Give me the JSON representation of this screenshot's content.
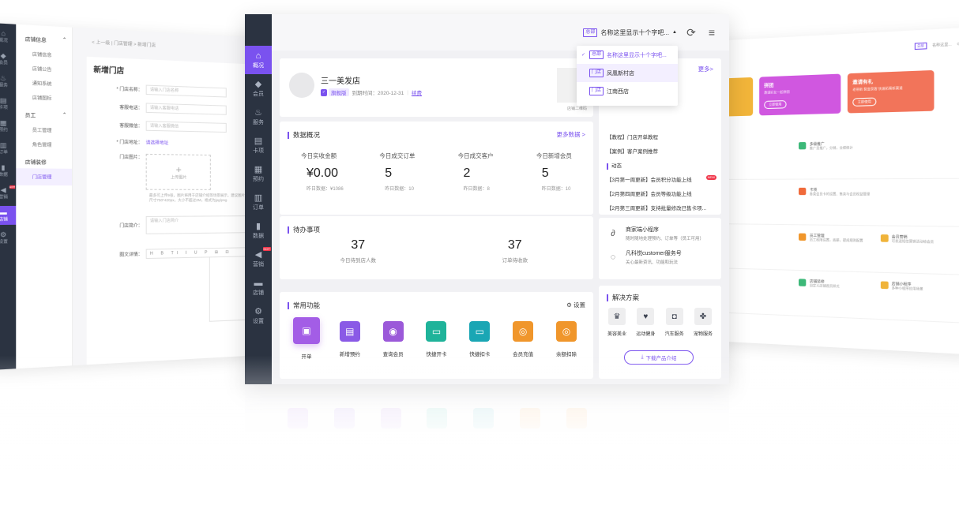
{
  "left_panel": {
    "sidebar": [
      {
        "label": "概况",
        "icon": "home-icon"
      },
      {
        "label": "会员",
        "icon": "diamond-icon"
      },
      {
        "label": "服务",
        "icon": "service-icon"
      },
      {
        "label": "卡项",
        "icon": "card-icon"
      },
      {
        "label": "预约",
        "icon": "calendar-icon"
      },
      {
        "label": "订单",
        "icon": "order-icon"
      },
      {
        "label": "数据",
        "icon": "chart-icon"
      },
      {
        "label": "营销",
        "icon": "megaphone-icon",
        "badge": "HOT"
      },
      {
        "label": "店铺",
        "icon": "shop-icon",
        "active": true
      },
      {
        "label": "设置",
        "icon": "gear-icon"
      }
    ],
    "submenu": {
      "group1": "店铺信息",
      "group1_items": [
        "店铺信息",
        "店铺公告",
        "通知系统",
        "店铺图标"
      ],
      "group2": "员工",
      "group2_items": [
        "员工管理",
        "角色管理"
      ],
      "group3": "店铺装修",
      "active_item": "门店管理"
    },
    "breadcrumb": "< 上一级 | 门店管理 > 新增门店",
    "form": {
      "title": "新增门店",
      "fields": [
        {
          "label": "* 门店名称：",
          "placeholder": "请输入门店名称"
        },
        {
          "label": "客服电话：",
          "placeholder": "请输入客服电话"
        },
        {
          "label": "客服微信：",
          "placeholder": "请输入客服微信"
        }
      ],
      "address_label": "* 门店地址：",
      "address_link": "请选择地址",
      "image_label": "门店图片：",
      "upload_label": "上传图片",
      "upload_hint": "最多可上传9张，图片将用于店铺介绍等场景展示，建议图片尺寸750*420px，大小不超过2M，格式为jpg/png",
      "intro_label": "门店简介：",
      "intro_placeholder": "请输入门店简介",
      "detail_label": "图文详情：",
      "toolbar": "H B TI I U P ⊞ ⊟"
    }
  },
  "center_panel": {
    "sidebar": [
      {
        "label": "概况",
        "icon": "home-icon",
        "active": true
      },
      {
        "label": "会员",
        "icon": "diamond-icon"
      },
      {
        "label": "服务",
        "icon": "service-icon"
      },
      {
        "label": "卡项",
        "icon": "card-icon"
      },
      {
        "label": "预约",
        "icon": "calendar-icon"
      },
      {
        "label": "订单",
        "icon": "order-icon"
      },
      {
        "label": "数据",
        "icon": "chart-icon"
      },
      {
        "label": "营销",
        "icon": "megaphone-icon",
        "badge": "HOT"
      },
      {
        "label": "店铺",
        "icon": "shop-icon"
      },
      {
        "label": "设置",
        "icon": "gear-icon"
      }
    ],
    "topbar": {
      "store_tag": "总部",
      "store_name": "名称这里显示十个字吧..."
    },
    "dropdown": [
      {
        "tag": "总部",
        "name": "名称这里显示十个字吧...",
        "selected": true
      },
      {
        "tag": "门店",
        "name": "凤凰新村店",
        "hover": true
      },
      {
        "tag": "门店",
        "name": "江南西店"
      }
    ],
    "store": {
      "name": "三一美发店",
      "plan": "旗舰版",
      "expire": "到期时间：2020-12-31",
      "renew": "续费",
      "qr_label": "店铺二维码"
    },
    "overview": {
      "title": "数据概况",
      "more": "更多数据 >",
      "stats": [
        {
          "label": "今日实收金额",
          "value": "¥0.00",
          "yesterday": "昨日数据：¥1086"
        },
        {
          "label": "今日成交订单",
          "value": "5",
          "yesterday": "昨日数据：10"
        },
        {
          "label": "今日成交客户",
          "value": "2",
          "yesterday": "昨日数据：8"
        },
        {
          "label": "今日新增会员",
          "value": "5",
          "yesterday": "昨日数据：10"
        }
      ]
    },
    "todo": {
      "title": "待办事项",
      "items": [
        {
          "value": "37",
          "label": "今日待到店人数"
        },
        {
          "value": "37",
          "label": "订单待收款"
        }
      ]
    },
    "funcs": {
      "title": "常用功能",
      "settings": "⚙ 设置",
      "items": [
        {
          "label": "开单",
          "color": "#a35de6",
          "icon": "cashier-icon"
        },
        {
          "label": "新增预约",
          "color": "#8a5ae6",
          "icon": "booking-icon"
        },
        {
          "label": "查询会员",
          "color": "#9b59d9",
          "icon": "member-search-icon"
        },
        {
          "label": "快捷开卡",
          "color": "#1fb39a",
          "icon": "open-card-icon"
        },
        {
          "label": "快捷扣卡",
          "color": "#1aa6b4",
          "icon": "deduct-card-icon"
        },
        {
          "label": "会员充值",
          "color": "#f0962b",
          "icon": "recharge-icon"
        },
        {
          "label": "余额扣除",
          "color": "#f0962b",
          "icon": "balance-deduct-icon"
        }
      ]
    },
    "news": {
      "more": "更多>",
      "items": [
        "【教程】门店开单教程",
        "【案例】客户案例推荐"
      ],
      "section": "动态",
      "updates": [
        {
          "text": "【3月第一周更新】会员积分功能上线",
          "badge": "NEW"
        },
        {
          "text": "【2月第四周更新】会员等级功能上线"
        },
        {
          "text": "【2月第三周更新】支持批量修改已售卡项..."
        }
      ]
    },
    "mini": [
      {
        "title": "商家端小程序",
        "sub": "随时随地处理预约、订单等（员工可用）",
        "icon": "mini-program-icon"
      },
      {
        "title": "凡科悦customer服务号",
        "sub": "关心最新资讯、功能和玩法",
        "icon": "service-account-icon"
      }
    ],
    "solutions": {
      "title": "解决方案",
      "items": [
        {
          "label": "美容美业",
          "icon": "beauty-icon"
        },
        {
          "label": "运动健身",
          "icon": "fitness-icon"
        },
        {
          "label": "汽车服务",
          "icon": "car-icon"
        },
        {
          "label": "宠物服务",
          "icon": "pet-icon"
        }
      ],
      "download": "下载产品介绍"
    }
  },
  "right_panel": {
    "topbar": {
      "tag": "总部",
      "name": "名称这里..."
    },
    "cards": [
      {
        "title": "拼团",
        "sub": "邀请好友一起拼团",
        "btn": "立即使用",
        "color": "#d057e0"
      },
      {
        "title": "邀请有礼",
        "sub": "老带新 裂变获客 快速拓客新渠道",
        "btn": "立即使用",
        "color": "#f2745a"
      }
    ],
    "grid": [
      [
        {
          "t": "",
          "s": ""
        },
        {
          "t": "多级推广",
          "s": "推广员推广，分销，业绩统计"
        },
        {
          "t": "",
          "s": ""
        }
      ],
      [
        {
          "t": "",
          "s": ""
        },
        {
          "t": "卡项",
          "s": "各类会员卡的设置、售卖与会员权益管理"
        },
        {
          "t": "",
          "s": ""
        }
      ],
      [
        {
          "t": "",
          "s": ""
        },
        {
          "t": "员工管理",
          "s": "员工权限设置，底薪，提成规则配置"
        },
        {
          "t": "会员营销",
          "s": "可发送短信营销活动给会员"
        }
      ],
      [
        {
          "t": "",
          "s": ""
        },
        {
          "t": "店铺装修",
          "s": "自定义店铺首页样式"
        },
        {
          "t": "店铺小程序",
          "s": "多种小程序应用场景"
        }
      ]
    ]
  }
}
